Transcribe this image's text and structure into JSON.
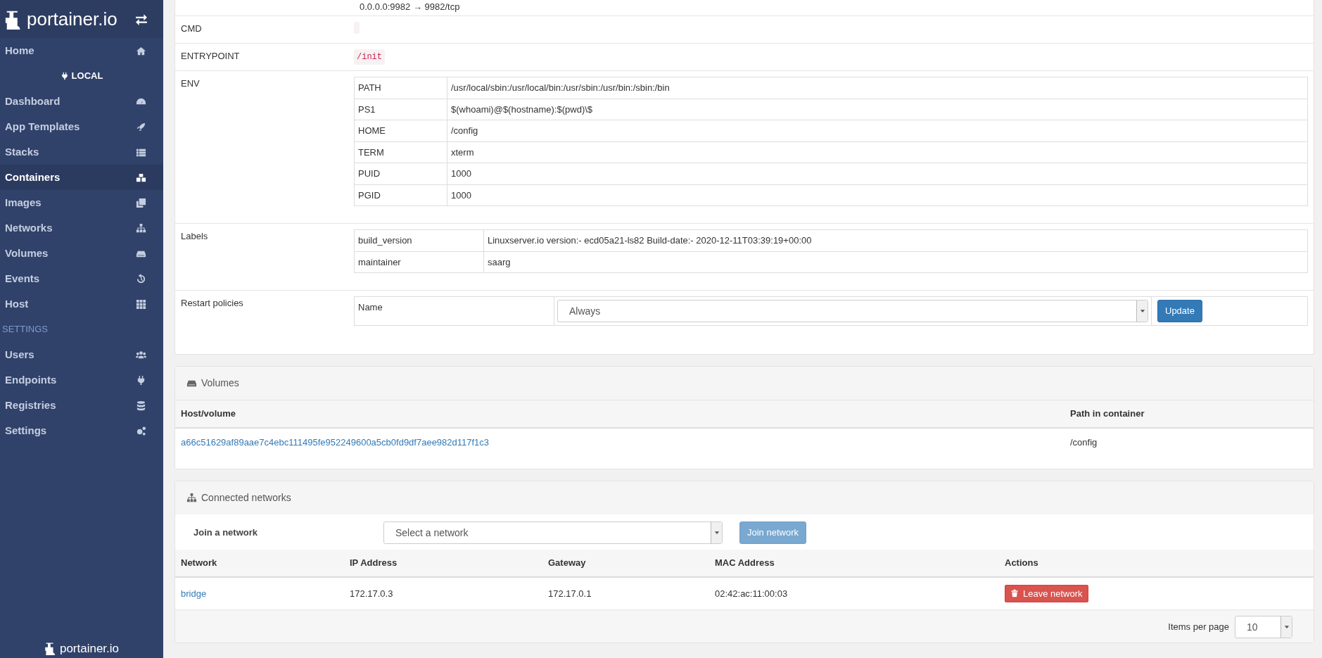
{
  "sidebar": {
    "logo": "portainer.io",
    "items": [
      {
        "kind": "item",
        "label": "Home",
        "selected": false
      },
      {
        "kind": "endpoint",
        "label": "LOCAL"
      },
      {
        "kind": "item",
        "label": "Dashboard",
        "selected": false
      },
      {
        "kind": "item",
        "label": "App Templates",
        "selected": false
      },
      {
        "kind": "item",
        "label": "Stacks",
        "selected": false
      },
      {
        "kind": "item",
        "label": "Containers",
        "selected": true
      },
      {
        "kind": "item",
        "label": "Images",
        "selected": false
      },
      {
        "kind": "item",
        "label": "Networks",
        "selected": false
      },
      {
        "kind": "item",
        "label": "Volumes",
        "selected": false
      },
      {
        "kind": "item",
        "label": "Events",
        "selected": false
      },
      {
        "kind": "item",
        "label": "Host",
        "selected": false
      },
      {
        "kind": "heading",
        "label": "SETTINGS"
      },
      {
        "kind": "item",
        "label": "Users",
        "selected": false
      },
      {
        "kind": "item",
        "label": "Endpoints",
        "selected": false
      },
      {
        "kind": "item",
        "label": "Registries",
        "selected": false
      },
      {
        "kind": "item",
        "label": "Settings",
        "selected": false
      }
    ],
    "footer_logo": "portainer.io"
  },
  "details": {
    "ports_line": "0.0.0.0:9982 → 9982/tcp",
    "rows": [
      {
        "kind": "code",
        "label": "CMD"
      },
      {
        "kind": "code",
        "label": "ENTRYPOINT",
        "value": "/init"
      },
      {
        "kind": "table",
        "label": "ENV",
        "pairs": [
          {
            "key": "PATH",
            "value": "/usr/local/sbin:/usr/local/bin:/usr/sbin:/usr/bin:/sbin:/bin"
          },
          {
            "key": "PS1",
            "value": "$(whoami)@$(hostname):$(pwd)\\$"
          },
          {
            "key": "HOME",
            "value": "/config"
          },
          {
            "key": "TERM",
            "value": "xterm"
          },
          {
            "key": "PUID",
            "value": "1000"
          },
          {
            "key": "PGID",
            "value": "1000"
          }
        ]
      },
      {
        "kind": "table",
        "label": "Labels",
        "pairs": [
          {
            "key": "build_version",
            "value": "Linuxserver.io version:- ecd05a21-ls82 Build-date:- 2020-12-11T03:39:19+00:00"
          },
          {
            "key": "maintainer",
            "value": "saarg"
          }
        ]
      },
      {
        "kind": "restart",
        "label": "Restart policies",
        "name_label": "Name",
        "value": "Always",
        "button": "Update"
      }
    ]
  },
  "volumes": {
    "title": "Volumes",
    "columns": [
      "Host/volume",
      "Path in container"
    ],
    "rows": [
      {
        "host_volume": "a66c51629af89aae7c4ebc111495fe952249600a5cb0fd9df7aee982d117f1c3",
        "path": "/config"
      }
    ]
  },
  "networks": {
    "title": "Connected networks",
    "join_label": "Join a network",
    "select_placeholder": "Select a network",
    "join_button": {
      "label": "Join network",
      "disabled": true
    },
    "columns": [
      "Network",
      "IP Address",
      "Gateway",
      "MAC Address",
      "Actions"
    ],
    "rows": [
      {
        "network": "bridge",
        "ip": "172.17.0.3",
        "gateway": "172.17.0.1",
        "mac": "02:42:ac:11:00:03",
        "action": "Leave network"
      }
    ],
    "pagination": {
      "label": "Items per page",
      "value": "10"
    }
  }
}
